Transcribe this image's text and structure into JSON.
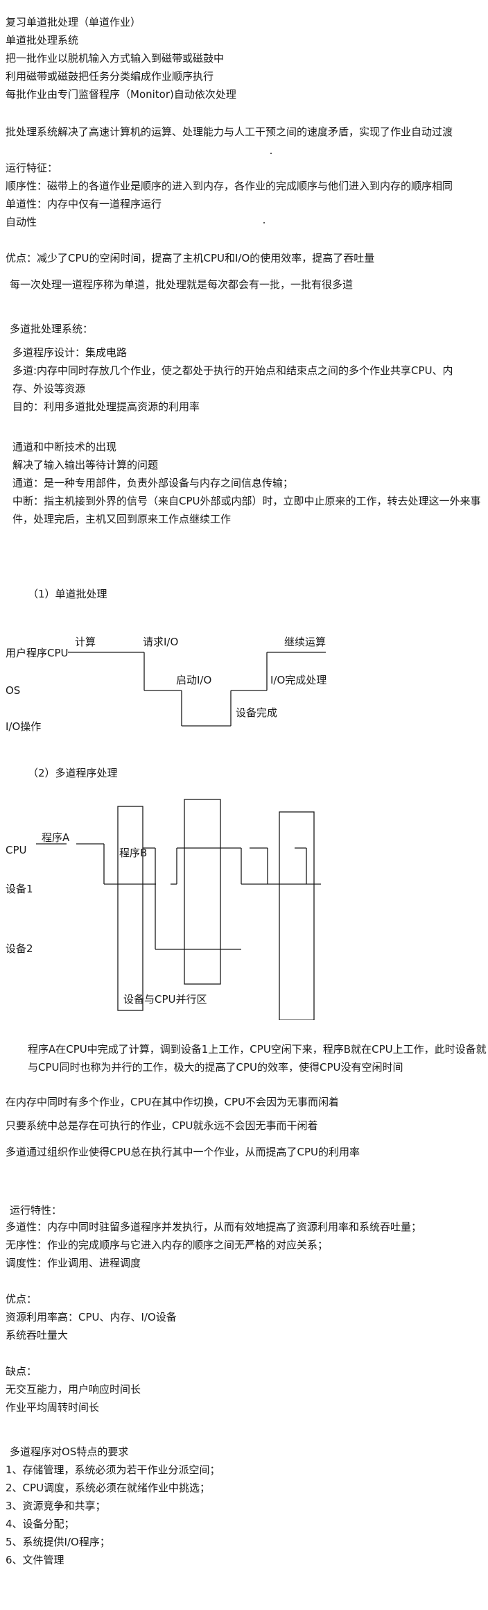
{
  "sec1": {
    "title": "复习单道批处理（单道作业）",
    "lines": [
      "单道批处理系统",
      "把一批作业以脱机输入方式输入到磁带或磁鼓中",
      "利用磁带或磁鼓把任务分类编成作业顺序执行",
      "每批作业由专门监督程序（Monitor)自动依次处理"
    ],
    "summary": "批处理系统解决了高速计算机的运算、处理能力与人工干预之间的速度矛盾，实现了作业自动过渡"
  },
  "features1": {
    "title": "运行特征：",
    "lines": [
      "顺序性：磁带上的各道作业是顺序的进入到内存，各作业的完成顺序与他们进入到内存的顺序相同",
      "单道性：内存中仅有一道程序运行",
      "自动性"
    ]
  },
  "advantage1": "优点：减少了CPU的空闲时间，提高了主机CPU和I/O的使用效率，提高了吞吐量",
  "note1": "每一次处理一道程序称为单道，批处理就是每次都会有一批，一批有很多道",
  "multi": {
    "title": "多道批处理系统：",
    "lines": [
      "多道程序设计：集成电路",
      "多道:内存中同时存放几个作业，使之都处于执行的开始点和结束点之间的多个作业共享CPU、内",
      "存、外设等资源",
      "目的：利用多道批处理提高资源的利用率"
    ]
  },
  "interrupt": {
    "lines": [
      "通道和中断技术的出现",
      "解决了输入输出等待计算的问题",
      "通道：是一种专用部件，负责外部设备与内存之间信息传输；",
      "中断：指主机接到外界的信号（来自CPU外部或内部）时，立即中止原来的工作，转去处理这一外来事",
      "件，处理完后，主机又回到原来工作点继续工作"
    ]
  },
  "diagram1": {
    "caption": "（1）单道批处理",
    "rows": [
      "用户程序CPU",
      "OS",
      "I/O操作"
    ],
    "labels": [
      "计算",
      "请求I/O",
      "启动I/O",
      "继续运算",
      "I/O完成处理",
      "设备完成"
    ]
  },
  "diagram2": {
    "caption": "（2）多道程序处理",
    "rows": [
      "CPU",
      "设备1",
      "设备2"
    ],
    "labels": [
      "程序A",
      "程序B",
      "设备与CPU并行区"
    ]
  },
  "explain": {
    "lines": [
      "程序A在CPU中完成了计算，调到设备1上工作，CPU空闲下来，程序B就在CPU上工作，此时设备就",
      "与CPU同时也称为并行的工作，极大的提高了CPU的效率，使得CPU没有空闲时间"
    ]
  },
  "notes2": [
    "在内存中同时有多个作业，CPU在其中作切换，CPU不会因为无事而闲着",
    "只要系统中总是存在可执行的作业，CPU就永远不会因无事而干闲着",
    "多道通过组织作业使得CPU总在执行其中一个作业，从而提高了CPU的利用率"
  ],
  "features2": {
    "title": "运行特性：",
    "lines": [
      "多道性：内存中同时驻留多道程序并发执行，从而有效地提高了资源利用率和系统吞吐量；",
      "无序性：作业的完成顺序与它进入内存的顺序之间无严格的对应关系；",
      "调度性：作业调用、进程调度"
    ]
  },
  "pros": {
    "title": "优点：",
    "lines": [
      "资源利用率高：CPU、内存、I/O设备",
      "系统吞吐量大"
    ]
  },
  "cons": {
    "title": "缺点：",
    "lines": [
      "无交互能力，用户响应时间长",
      "作业平均周转时间长"
    ]
  },
  "requirements": {
    "title": "多道程序对OS特点的要求",
    "lines": [
      "1、存储管理，系统必须为若干作业分派空间；",
      "2、CPU调度，系统必须在就绪作业中挑选；",
      "3、资源竞争和共享；",
      "4、设备分配；",
      "5、系统提供I/O程序；",
      "6、文件管理"
    ]
  }
}
